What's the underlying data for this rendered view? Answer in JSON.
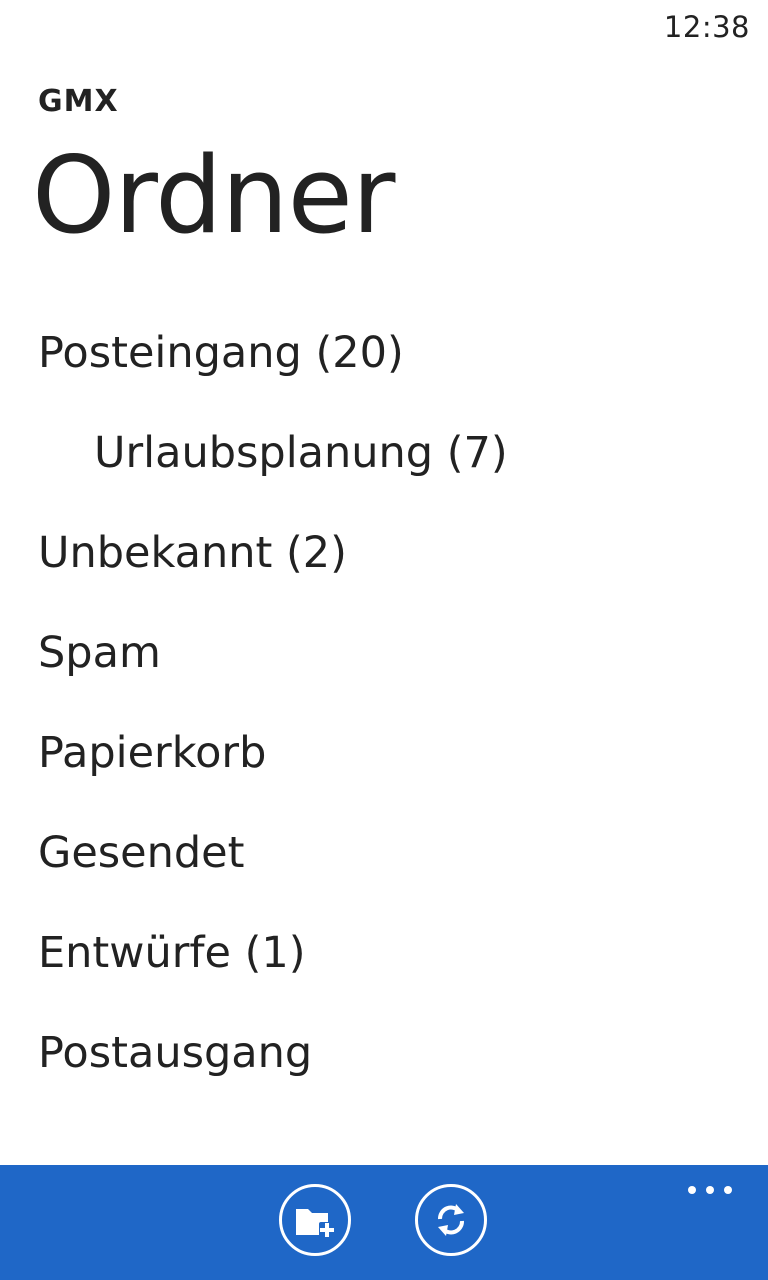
{
  "status_bar": {
    "time": "12:38"
  },
  "header": {
    "app_name": "GMX",
    "title": "Ordner"
  },
  "folders": [
    {
      "label": "Posteingang (20)",
      "level": 0
    },
    {
      "label": "Urlaubsplanung (7)",
      "level": 1
    },
    {
      "label": "Unbekannt (2)",
      "level": 0
    },
    {
      "label": "Spam",
      "level": 0
    },
    {
      "label": "Papierkorb",
      "level": 0
    },
    {
      "label": "Gesendet",
      "level": 0
    },
    {
      "label": "Entwürfe (1)",
      "level": 0
    },
    {
      "label": "Postausgang",
      "level": 0
    }
  ],
  "app_bar": {
    "background": "#1f67c7",
    "buttons": [
      {
        "icon": "new-folder-icon"
      },
      {
        "icon": "sync-icon"
      }
    ],
    "more_icon": "ellipsis-icon"
  }
}
